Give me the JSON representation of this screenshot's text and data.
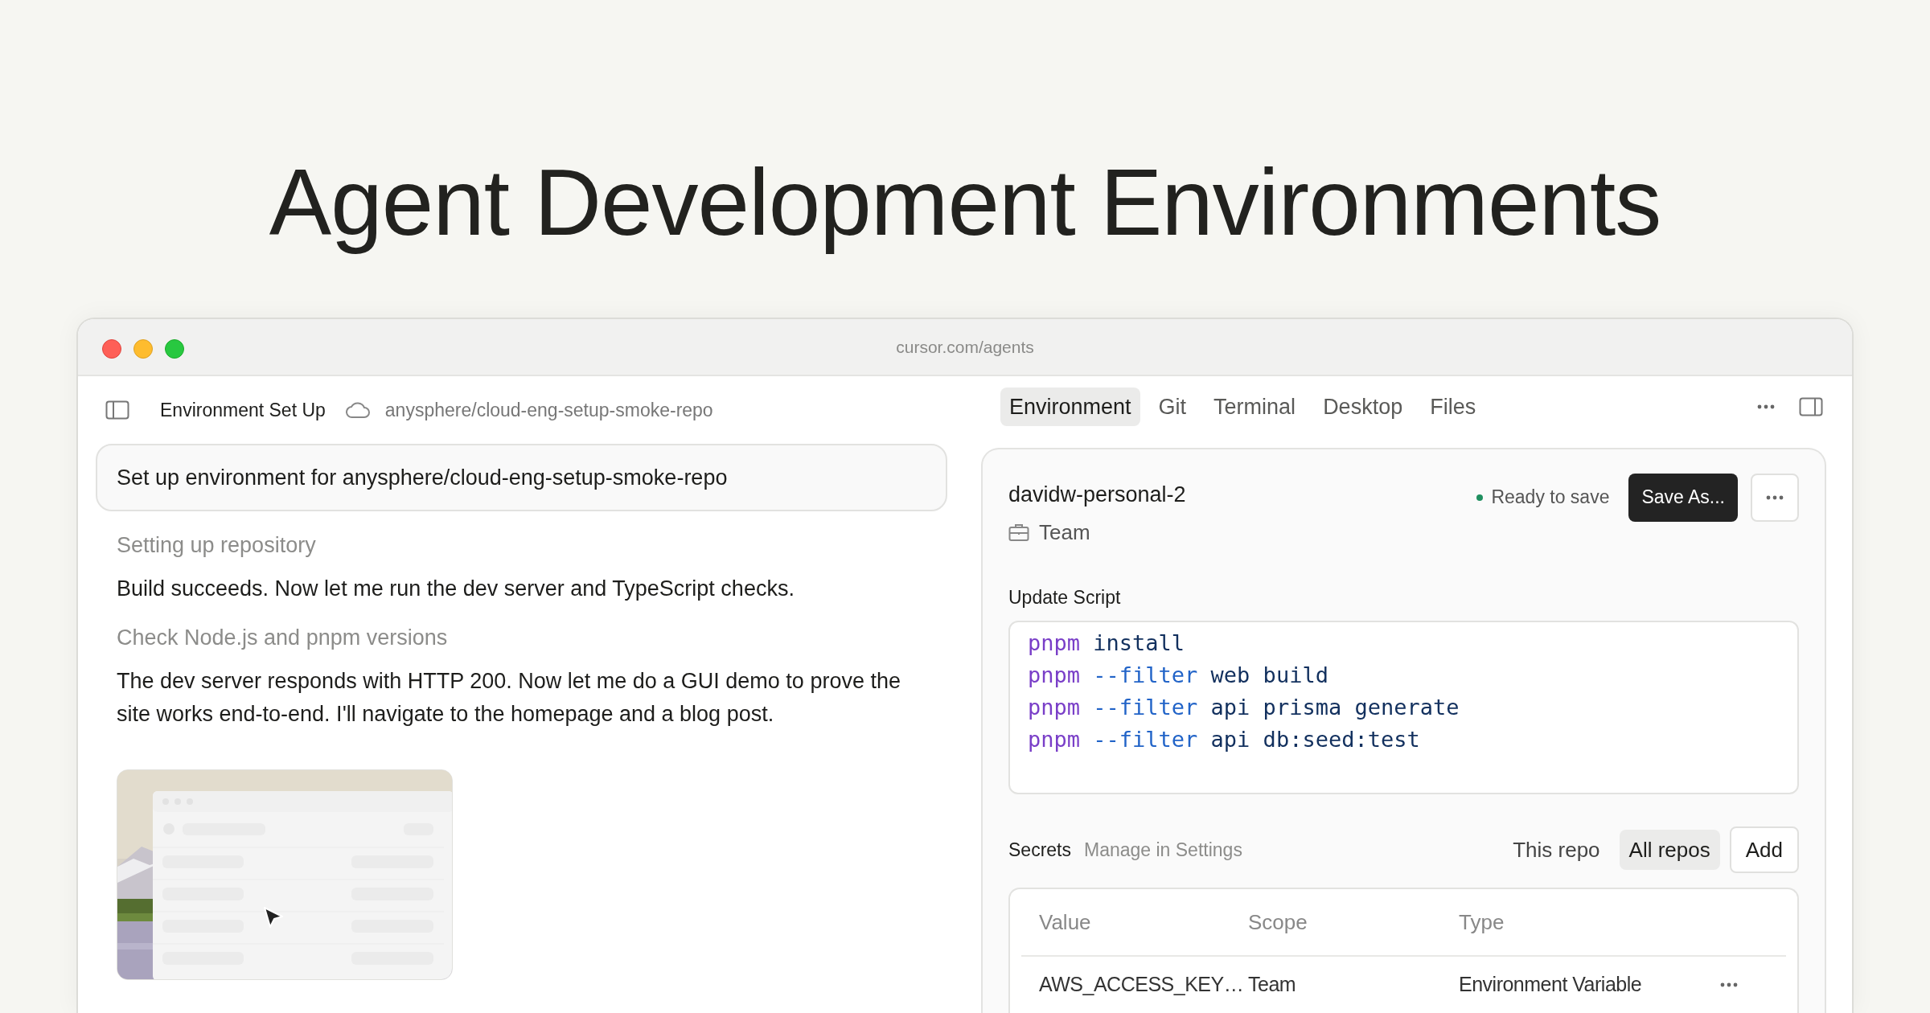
{
  "headline": "Agent Development Environments",
  "browser": {
    "url": "cursor.com/agents"
  },
  "chat": {
    "title": "Environment Set Up",
    "repo": "anysphere/cloud-eng-setup-smoke-repo",
    "prompt": "Set up environment for anysphere/cloud-eng-setup-smoke-repo",
    "log": [
      {
        "kind": "step",
        "text": "Setting up repository"
      },
      {
        "kind": "message",
        "text": "Build succeeds. Now let me run the dev server and TypeScript checks."
      },
      {
        "kind": "step",
        "text": "Check Node.js and pnpm versions"
      },
      {
        "kind": "message",
        "text": "The dev server responds with HTTP 200. Now let me do a GUI demo to prove the site works end-to-end. I'll navigate to the homepage and a blog post."
      }
    ]
  },
  "tabs": [
    {
      "label": "Environment",
      "selected": true
    },
    {
      "label": "Git",
      "selected": false
    },
    {
      "label": "Terminal",
      "selected": false
    },
    {
      "label": "Desktop",
      "selected": false
    },
    {
      "label": "Files",
      "selected": false
    }
  ],
  "environment": {
    "name": "davidw-personal-2",
    "status": "Ready to save",
    "save_button": "Save As...",
    "scope": "Team",
    "script_label": "Update Script",
    "script": [
      [
        {
          "kind": "cmd",
          "text": "pnpm"
        },
        {
          "kind": "arg",
          "text": "install"
        }
      ],
      [
        {
          "kind": "cmd",
          "text": "pnpm"
        },
        {
          "kind": "flag",
          "text": "--filter"
        },
        {
          "kind": "arg",
          "text": "web build"
        }
      ],
      [
        {
          "kind": "cmd",
          "text": "pnpm"
        },
        {
          "kind": "flag",
          "text": "--filter"
        },
        {
          "kind": "arg",
          "text": "api prisma generate"
        }
      ],
      [
        {
          "kind": "cmd",
          "text": "pnpm"
        },
        {
          "kind": "flag",
          "text": "--filter"
        },
        {
          "kind": "arg",
          "text": "api db:seed:test"
        }
      ]
    ]
  },
  "secrets": {
    "label": "Secrets",
    "link": "Manage in Settings",
    "filters": [
      {
        "label": "This repo",
        "selected": false
      },
      {
        "label": "All repos",
        "selected": true
      }
    ],
    "add_button": "Add",
    "columns": [
      "Value",
      "Scope",
      "Type"
    ],
    "rows": [
      [
        "AWS_ACCESS_KEY…",
        "Team",
        "Environment Variable"
      ]
    ]
  }
}
